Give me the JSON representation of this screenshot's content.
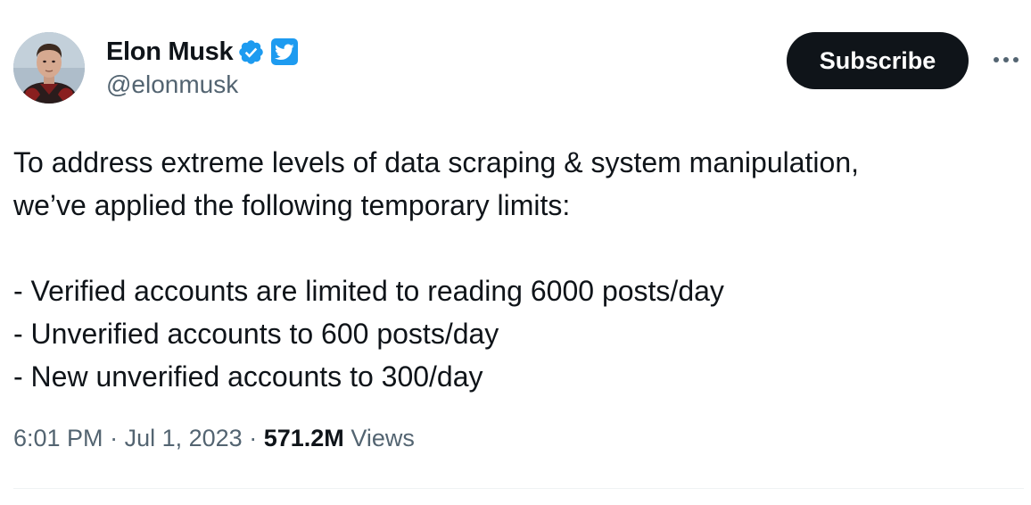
{
  "author": {
    "display_name": "Elon Musk",
    "handle": "@elonmusk",
    "avatar_icon": "avatar-photo",
    "verified_badge_icon": "verified-checkmark-icon",
    "affiliate_badge_icon": "twitter-bird-icon",
    "verified_color": "#1d9bf0"
  },
  "actions": {
    "subscribe_label": "Subscribe",
    "more_icon": "more-horizontal-icon"
  },
  "tweet": {
    "lines": [
      "To address extreme levels of data scraping & system manipulation,",
      "we’ve applied the following temporary limits:",
      "",
      "- Verified accounts are limited to reading 6000 posts/day",
      "- Unverified accounts to 600 posts/day",
      "- New unverified accounts to 300/day"
    ]
  },
  "meta": {
    "time": "6:01 PM",
    "separator": "·",
    "date": "Jul 1, 2023",
    "views_count": "571.2M",
    "views_label": "Views"
  },
  "colors": {
    "text_primary": "#0f1419",
    "text_secondary": "#536471",
    "accent": "#1d9bf0",
    "button_bg": "#0f1419"
  }
}
